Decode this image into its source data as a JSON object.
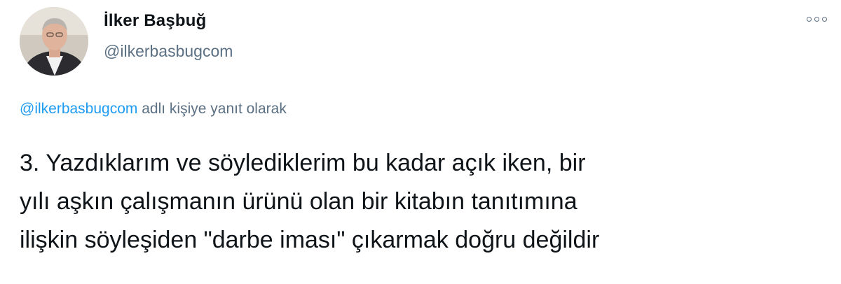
{
  "author": {
    "display_name": "İlker Başbuğ",
    "handle": "@ilkerbasbugcom",
    "avatar": "profile-photo"
  },
  "menu": {
    "icon": "more-options-icon"
  },
  "reply_context": {
    "mention": "@ilkerbasbugcom",
    "suffix": " adlı kişiye yanıt olarak"
  },
  "tweet": {
    "lines": [
      "3. Yazdıklarım ve söylediklerim bu kadar açık iken, bir",
      "yılı aşkın çalışmanın ürünü olan bir kitabın tanıtımına",
      "ilişkin söyleşiden \"darbe iması\" çıkarmak doğru değildir"
    ]
  },
  "colors": {
    "text": "#0f1419",
    "secondary": "#5b7083",
    "link": "#1d9bf0"
  }
}
